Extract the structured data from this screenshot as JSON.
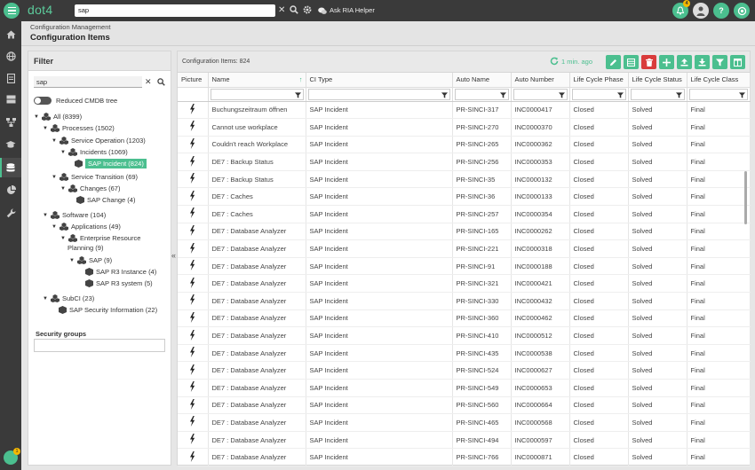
{
  "app": {
    "logo": "dot4"
  },
  "topbar": {
    "search_value": "sap",
    "ria_label": "Ask RIA Helper",
    "notification_count": "4"
  },
  "nav": {
    "user_badge": "1"
  },
  "header": {
    "breadcrumb": "Configuration Management",
    "title": "Configuration Items"
  },
  "filter": {
    "title": "Filter",
    "search_value": "sap",
    "toggle_label": "Reduced CMDB tree",
    "tree": [
      {
        "label": "All (8399)"
      },
      {
        "label": "Processes (1502)"
      },
      {
        "label": "Service Operation (1203)"
      },
      {
        "label": "Incidents (1069)"
      },
      {
        "label": "SAP Incident (824)"
      },
      {
        "label": "Service Transition (69)"
      },
      {
        "label": "Changes (67)"
      },
      {
        "label": "SAP Change (4)"
      },
      {
        "label": "Software (104)"
      },
      {
        "label": "Applications (49)"
      },
      {
        "label": "Enterprise Resource"
      },
      {
        "label": "Planning (9)"
      },
      {
        "label": "SAP (9)"
      },
      {
        "label": "SAP R3 Instance (4)"
      },
      {
        "label": "SAP R3 system (5)"
      },
      {
        "label": "SubCI (23)"
      },
      {
        "label": "SAP Security Information (22)"
      }
    ],
    "security_groups": "Security groups"
  },
  "grid": {
    "count_label": "Configuration Items: 824",
    "refresh_label": "1 min. ago",
    "columns": [
      "Picture",
      "Name",
      "CI Type",
      "Auto Name",
      "Auto Number",
      "Life Cycle Phase",
      "Life Cycle Status",
      "Life Cycle Class"
    ],
    "rows": [
      [
        "Buchungszeitraum öffnen",
        "SAP Incident",
        "PR-SINCI-317",
        "INC0000417",
        "Closed",
        "Solved",
        "Final"
      ],
      [
        "Cannot use workplace",
        "SAP Incident",
        "PR-SINCI-270",
        "INC0000370",
        "Closed",
        "Solved",
        "Final"
      ],
      [
        "Couldn't reach Workplace",
        "SAP Incident",
        "PR-SINCI-265",
        "INC0000362",
        "Closed",
        "Solved",
        "Final"
      ],
      [
        "DE7 : Backup Status",
        "SAP Incident",
        "PR-SINCI-256",
        "INC0000353",
        "Closed",
        "Solved",
        "Final"
      ],
      [
        "DE7 : Backup Status",
        "SAP Incident",
        "PR-SINCI-35",
        "INC0000132",
        "Closed",
        "Solved",
        "Final"
      ],
      [
        "DE7 : Caches",
        "SAP Incident",
        "PR-SINCI-36",
        "INC0000133",
        "Closed",
        "Solved",
        "Final"
      ],
      [
        "DE7 : Caches",
        "SAP Incident",
        "PR-SINCI-257",
        "INC0000354",
        "Closed",
        "Solved",
        "Final"
      ],
      [
        "DE7 : Database Analyzer",
        "SAP Incident",
        "PR-SINCI-165",
        "INC0000262",
        "Closed",
        "Solved",
        "Final"
      ],
      [
        "DE7 : Database Analyzer",
        "SAP Incident",
        "PR-SINCI-221",
        "INC0000318",
        "Closed",
        "Solved",
        "Final"
      ],
      [
        "DE7 : Database Analyzer",
        "SAP Incident",
        "PR-SINCI-91",
        "INC0000188",
        "Closed",
        "Solved",
        "Final"
      ],
      [
        "DE7 : Database Analyzer",
        "SAP Incident",
        "PR-SINCI-321",
        "INC0000421",
        "Closed",
        "Solved",
        "Final"
      ],
      [
        "DE7 : Database Analyzer",
        "SAP Incident",
        "PR-SINCI-330",
        "INC0000432",
        "Closed",
        "Solved",
        "Final"
      ],
      [
        "DE7 : Database Analyzer",
        "SAP Incident",
        "PR-SINCI-360",
        "INC0000462",
        "Closed",
        "Solved",
        "Final"
      ],
      [
        "DE7 : Database Analyzer",
        "SAP Incident",
        "PR-SINCI-410",
        "INC0000512",
        "Closed",
        "Solved",
        "Final"
      ],
      [
        "DE7 : Database Analyzer",
        "SAP Incident",
        "PR-SINCI-435",
        "INC0000538",
        "Closed",
        "Solved",
        "Final"
      ],
      [
        "DE7 : Database Analyzer",
        "SAP Incident",
        "PR-SINCI-524",
        "INC0000627",
        "Closed",
        "Solved",
        "Final"
      ],
      [
        "DE7 : Database Analyzer",
        "SAP Incident",
        "PR-SINCI-549",
        "INC0000653",
        "Closed",
        "Solved",
        "Final"
      ],
      [
        "DE7 : Database Analyzer",
        "SAP Incident",
        "PR-SINCI-560",
        "INC0000664",
        "Closed",
        "Solved",
        "Final"
      ],
      [
        "DE7 : Database Analyzer",
        "SAP Incident",
        "PR-SINCI-465",
        "INC0000568",
        "Closed",
        "Solved",
        "Final"
      ],
      [
        "DE7 : Database Analyzer",
        "SAP Incident",
        "PR-SINCI-494",
        "INC0000597",
        "Closed",
        "Solved",
        "Final"
      ],
      [
        "DE7 : Database Analyzer",
        "SAP Incident",
        "PR-SINCI-766",
        "INC0000871",
        "Closed",
        "Solved",
        "Final"
      ]
    ]
  },
  "colors": {
    "accent": "#4bbf8f",
    "topbar": "#3a3a3a",
    "delete": "#d93b3b"
  }
}
